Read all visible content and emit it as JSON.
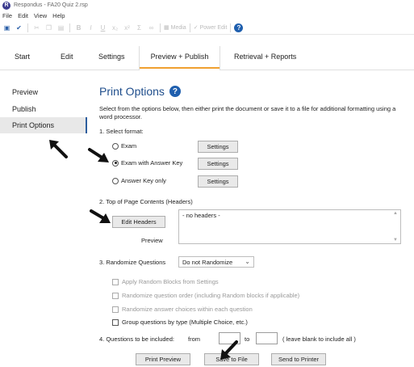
{
  "window": {
    "app_icon": "R",
    "title": "Respondus - FA20 Quiz 2.rsp"
  },
  "menu": [
    "File",
    "Edit",
    "View",
    "Help"
  ],
  "toolbar": {
    "media_label": "Media",
    "power_edit_label": "Power Edit"
  },
  "tabs": [
    "Start",
    "Edit",
    "Settings",
    "Preview + Publish",
    "Retrieval + Reports"
  ],
  "sidebar": {
    "items": [
      "Preview",
      "Publish",
      "Print Options"
    ]
  },
  "main": {
    "title": "Print Options",
    "intro": "Select from the options below, then either print the document or save it to a file for additional formatting using a word processor.",
    "section1": {
      "label": "1.  Select format:",
      "options": [
        "Exam",
        "Exam with Answer Key",
        "Answer Key only"
      ],
      "selected": "Exam with Answer Key",
      "settings_label": "Settings"
    },
    "section2": {
      "label": "2.  Top of Page Contents (Headers)",
      "edit_button": "Edit Headers",
      "headers_value": "- no headers -",
      "preview_label": "Preview"
    },
    "section3": {
      "label": "3.  Randomize Questions",
      "select_value": "Do not Randomize",
      "checks": [
        "Apply Random Blocks from Settings",
        "Randomize question order (including Random blocks if applicable)",
        "Randomize answer choices within each question",
        "Group questions by type (Multiple Choice, etc.)"
      ]
    },
    "section4": {
      "label": "4.  Questions to be included:",
      "from_label": "from",
      "to_label": "to",
      "from_value": "",
      "to_value": "",
      "hint": "( leave blank to include all )"
    },
    "buttons": {
      "print_preview": "Print Preview",
      "save_to_file": "Save to File",
      "send_to_printer": "Send to Printer"
    }
  },
  "colors": {
    "accent": "#1f4e8c",
    "tab_underline": "#f0a030",
    "sidebar_selected": "#e8e8e8"
  }
}
